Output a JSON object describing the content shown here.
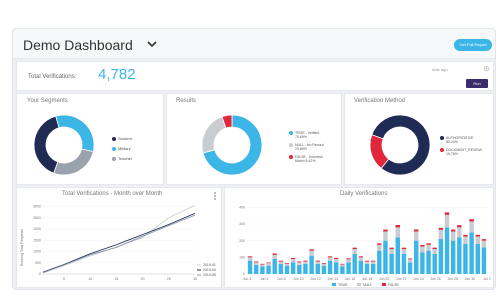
{
  "header": {
    "title": "Demo Dashboard",
    "report_button": "Get Full Report"
  },
  "kpi": {
    "label": "Total Verifications:",
    "value": "4,782",
    "date_label": "date ago",
    "run_button": "Run"
  },
  "colors": {
    "accent": "#3bb6e6",
    "navy": "#1f2a55",
    "grey": "#c9ccd1",
    "red": "#e0283a",
    "purple": "#3a2d6b"
  },
  "segments": {
    "title": "Your Segments",
    "legend": [
      {
        "label": "Student",
        "color": "#1f2a55"
      },
      {
        "label": "Military",
        "color": "#3bb6e6"
      },
      {
        "label": "Teacher",
        "color": "#9aa3ad"
      }
    ],
    "chart_data": {
      "type": "pie",
      "categories": [
        "Student",
        "Military",
        "Teacher"
      ],
      "values": [
        40,
        33,
        27
      ]
    }
  },
  "results": {
    "title": "Results",
    "legend": [
      {
        "label": "TRUE - Verified",
        "sub": "70.69%",
        "color": "#3bb6e6"
      },
      {
        "label": "NULL - No Record",
        "sub": "23.89%",
        "color": "#c9ccd1"
      },
      {
        "label": "FALSE - Incorrect",
        "sub": "Match 5.42%",
        "color": "#e0283a"
      }
    ],
    "chart_data": {
      "type": "pie",
      "categories": [
        "TRUE",
        "NULL",
        "FALSE"
      ],
      "values": [
        70.69,
        23.89,
        5.42
      ]
    }
  },
  "method": {
    "title": "Verification Method",
    "legend": [
      {
        "label": "AUTHORITATIVE",
        "sub": "80.24%",
        "color": "#1f2a55"
      },
      {
        "label": "DOCUMENT_REVIEW",
        "sub": "19.76%",
        "color": "#e0283a"
      }
    ],
    "chart_data": {
      "type": "pie",
      "categories": [
        "AUTHORITATIVE",
        "DOCUMENT_REVIEW"
      ],
      "values": [
        80.24,
        19.76
      ]
    }
  },
  "monthly": {
    "title": "Total Verifications - Month over Month",
    "ylabel": "Running Total Requests",
    "legend": [
      "2019-01",
      "2019-04",
      "2019-05"
    ],
    "chart_data": {
      "type": "line",
      "x": [
        1,
        5,
        10,
        15,
        20,
        25,
        30
      ],
      "xticks": [
        "5",
        "10",
        "15",
        "20",
        "25",
        "30"
      ],
      "yticks": [
        "0",
        "500",
        "1000",
        "1500",
        "2000",
        "2500",
        "3000"
      ],
      "ylim": [
        0,
        3200
      ],
      "series": [
        {
          "name": "2019-01",
          "color": "#c9ccd1",
          "values": [
            50,
            380,
            800,
            1200,
            1620,
            2500,
            3050
          ]
        },
        {
          "name": "2019-04",
          "color": "#1f2a55",
          "values": [
            80,
            420,
            900,
            1300,
            1750,
            2200,
            2700
          ]
        },
        {
          "name": "2019-05",
          "color": "#8a96a8",
          "values": [
            60,
            400,
            860,
            1180,
            1680,
            2150,
            2620
          ]
        }
      ]
    }
  },
  "daily": {
    "title": "Daily Verifications",
    "legend": [
      {
        "label": "TRUE",
        "color": "#3bb6e6"
      },
      {
        "label": "NULL",
        "color": "#c9ccd1"
      },
      {
        "label": "FALSE",
        "color": "#e0283a"
      }
    ],
    "chart_data": {
      "type": "bar",
      "xticks": [
        "Jun 4",
        "Jun 6",
        "Jun 8",
        "Jun 10",
        "Jun 12",
        "Jun 14",
        "Jun 16",
        "Jun 18",
        "Jun 20",
        "Jun 22",
        "Jun 24",
        "Jun 26",
        "Jun 28",
        "Jun 30",
        "Jul 2"
      ],
      "yticks": [
        "0",
        "100",
        "200",
        "300",
        "400"
      ],
      "ylim": [
        0,
        420
      ],
      "series": [
        {
          "name": "TRUE",
          "color": "#3bb6e6",
          "values": [
            80,
            55,
            45,
            50,
            90,
            60,
            50,
            70,
            55,
            60,
            110,
            60,
            50,
            80,
            70,
            45,
            70,
            120,
            80,
            60,
            60,
            140,
            200,
            120,
            220,
            120,
            70,
            200,
            130,
            140,
            120,
            210,
            280,
            200,
            220,
            180,
            250,
            180,
            160
          ]
        },
        {
          "name": "NULL",
          "color": "#c9ccd1",
          "values": [
            20,
            15,
            12,
            15,
            25,
            15,
            12,
            20,
            15,
            15,
            30,
            15,
            12,
            20,
            20,
            12,
            18,
            30,
            20,
            15,
            15,
            35,
            55,
            30,
            60,
            30,
            18,
            55,
            35,
            35,
            30,
            55,
            75,
            55,
            60,
            45,
            65,
            45,
            40
          ]
        },
        {
          "name": "FALSE",
          "color": "#e0283a",
          "values": [
            6,
            5,
            4,
            4,
            8,
            5,
            4,
            6,
            5,
            5,
            8,
            5,
            4,
            6,
            6,
            4,
            6,
            8,
            6,
            5,
            5,
            9,
            12,
            8,
            14,
            8,
            5,
            12,
            9,
            9,
            8,
            12,
            15,
            12,
            13,
            10,
            14,
            10,
            9
          ]
        }
      ]
    }
  }
}
